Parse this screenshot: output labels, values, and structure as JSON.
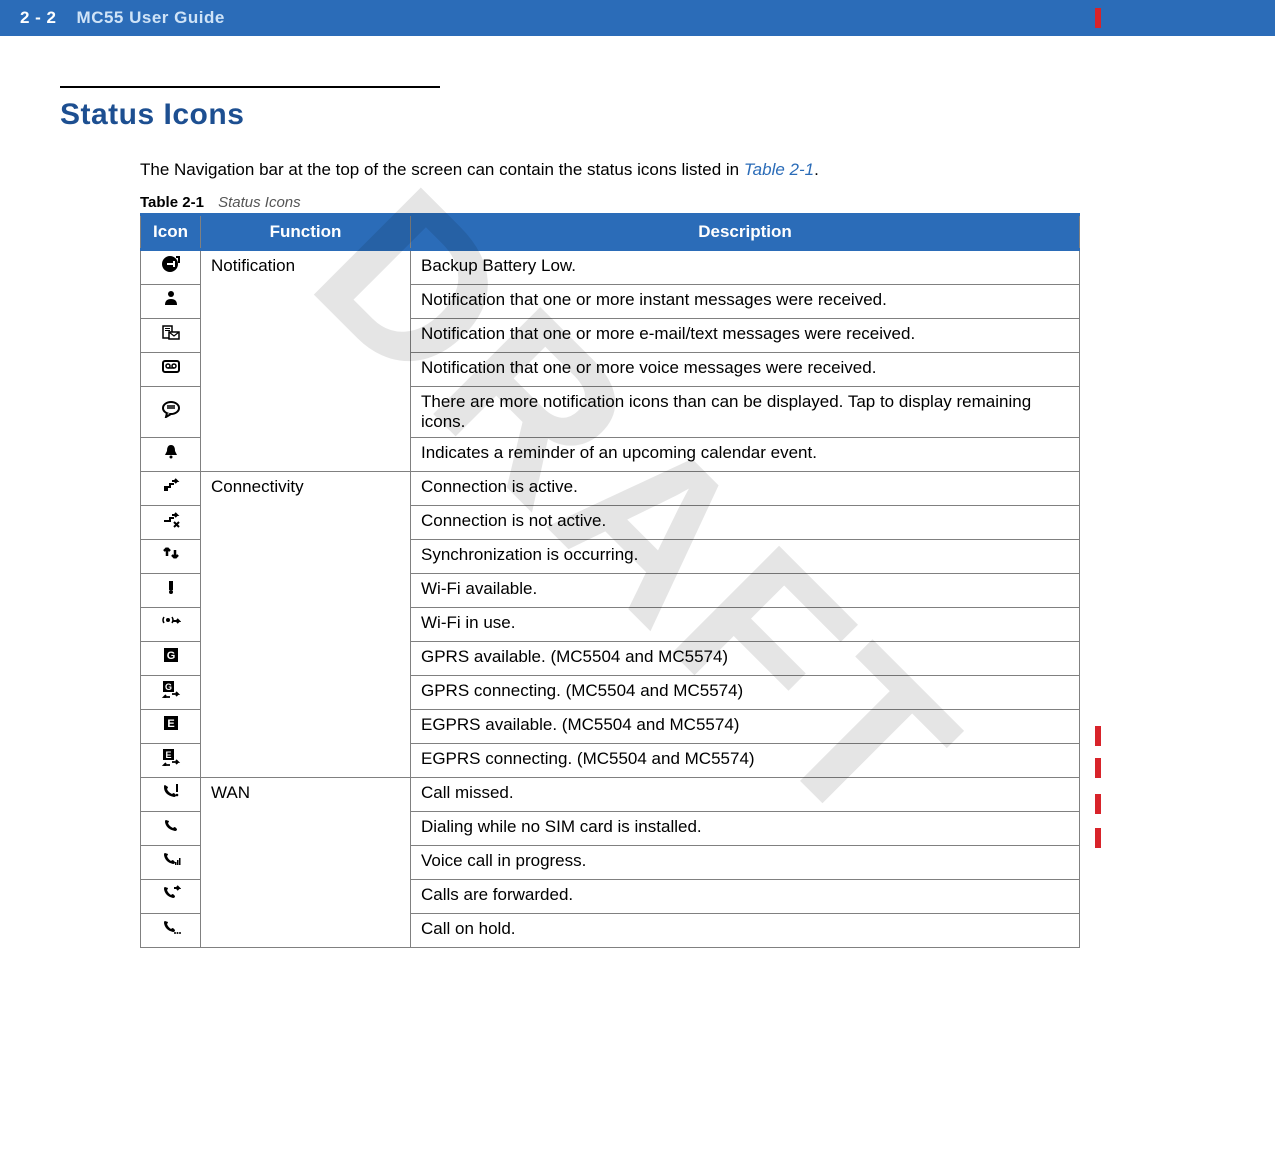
{
  "header": {
    "page_number": "2 - 2",
    "doc_title": "MC55 User Guide"
  },
  "watermark": "DRAFT",
  "section": {
    "title": "Status Icons",
    "intro_prefix": "The Navigation bar at the top of the screen can contain the status icons listed in ",
    "intro_link": "Table 2-1",
    "intro_suffix": "."
  },
  "table": {
    "caption_num": "Table 2-1",
    "caption_text": "Status Icons",
    "headers": {
      "icon": "Icon",
      "function": "Function",
      "description": "Description"
    },
    "groups": [
      {
        "function": "Notification",
        "rows": [
          {
            "icon": "battery-low-icon",
            "description": "Backup Battery Low."
          },
          {
            "icon": "im-icon",
            "description": "Notification that one or more instant messages were received."
          },
          {
            "icon": "mail-text-icon",
            "description": "Notification that one or more e-mail/text messages were received."
          },
          {
            "icon": "voicemail-icon",
            "description": "Notification that one or more voice messages were received."
          },
          {
            "icon": "more-notifications-icon",
            "description": "There are more notification icons than can be displayed. Tap to display remaining icons."
          },
          {
            "icon": "reminder-bell-icon",
            "description": "Indicates a reminder of an upcoming calendar event."
          }
        ]
      },
      {
        "function": "Connectivity",
        "rows": [
          {
            "icon": "connection-active-icon",
            "description": "Connection is active."
          },
          {
            "icon": "connection-inactive-icon",
            "description": "Connection is not active."
          },
          {
            "icon": "sync-icon",
            "description": "Synchronization is occurring."
          },
          {
            "icon": "wifi-available-icon",
            "description": "Wi-Fi available."
          },
          {
            "icon": "wifi-inuse-icon",
            "description": "Wi-Fi in use."
          },
          {
            "icon": "gprs-available-icon",
            "description": "GPRS available. (MC5504 and MC5574)"
          },
          {
            "icon": "gprs-connecting-icon",
            "description": "GPRS connecting. (MC5504 and MC5574)"
          },
          {
            "icon": "egprs-available-icon",
            "description": "EGPRS available. (MC5504 and MC5574)"
          },
          {
            "icon": "egprs-connecting-icon",
            "description": "EGPRS connecting. (MC5504 and MC5574)"
          }
        ]
      },
      {
        "function": "WAN",
        "rows": [
          {
            "icon": "call-missed-icon",
            "description": "Call missed."
          },
          {
            "icon": "no-sim-dial-icon",
            "description": "Dialing while no SIM card is installed."
          },
          {
            "icon": "voice-call-icon",
            "description": "Voice call in progress."
          },
          {
            "icon": "call-forward-icon",
            "description": "Calls are forwarded."
          },
          {
            "icon": "call-hold-icon",
            "description": "Call on hold."
          }
        ]
      }
    ]
  }
}
